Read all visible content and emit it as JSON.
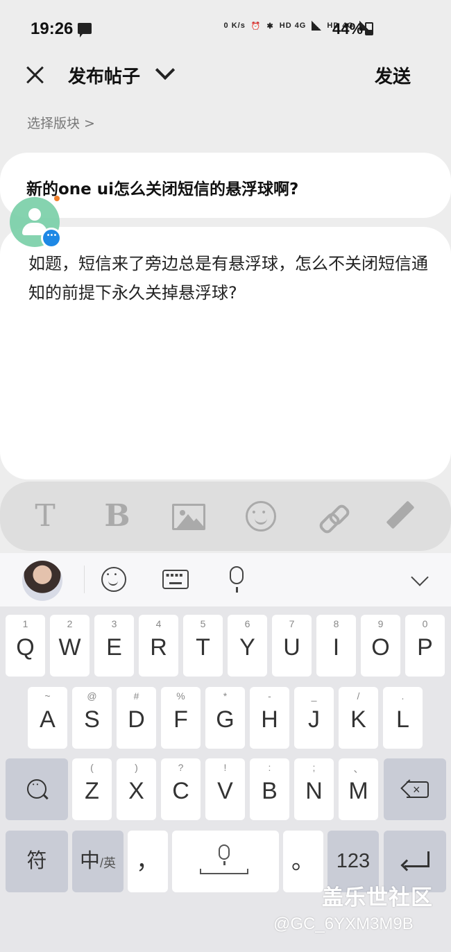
{
  "status_bar": {
    "time": "19:26",
    "net_speed": "0 K/s",
    "network_1": "HD 4G",
    "network_2": "HD 4G",
    "battery": "44%"
  },
  "header": {
    "title": "发布帖子",
    "send_label": "发送"
  },
  "board_selector": "选择版块 >",
  "post": {
    "title": "新的one ui怎么关闭短信的悬浮球啊?",
    "body": "如题，短信来了旁边总是有悬浮球，怎么不关闭短信通知的前提下永久关掉悬浮球?"
  },
  "format_toolbar": {
    "text_label": "T",
    "bold_label": "B"
  },
  "keyboard": {
    "row1": [
      {
        "hint": "1",
        "key": "Q"
      },
      {
        "hint": "2",
        "key": "W"
      },
      {
        "hint": "3",
        "key": "E"
      },
      {
        "hint": "4",
        "key": "R"
      },
      {
        "hint": "5",
        "key": "T"
      },
      {
        "hint": "6",
        "key": "Y"
      },
      {
        "hint": "7",
        "key": "U"
      },
      {
        "hint": "8",
        "key": "I"
      },
      {
        "hint": "9",
        "key": "O"
      },
      {
        "hint": "0",
        "key": "P"
      }
    ],
    "row2": [
      {
        "hint": "~",
        "key": "A"
      },
      {
        "hint": "@",
        "key": "S"
      },
      {
        "hint": "#",
        "key": "D"
      },
      {
        "hint": "%",
        "key": "F"
      },
      {
        "hint": "*",
        "key": "G"
      },
      {
        "hint": "-",
        "key": "H"
      },
      {
        "hint": "_",
        "key": "J"
      },
      {
        "hint": "/",
        "key": "K"
      },
      {
        "hint": ".",
        "key": "L"
      }
    ],
    "row3": [
      {
        "hint": "(",
        "key": "Z"
      },
      {
        "hint": ")",
        "key": "X"
      },
      {
        "hint": "?",
        "key": "C"
      },
      {
        "hint": "!",
        "key": "V"
      },
      {
        "hint": ":",
        "key": "B"
      },
      {
        "hint": ";",
        "key": "N"
      },
      {
        "hint": "、",
        "key": "M"
      }
    ],
    "bottom": {
      "symbols": "符",
      "lang_main": "中",
      "lang_sub": "/英",
      "comma": "，",
      "period": "。",
      "numbers": "123"
    }
  },
  "watermark": {
    "site": "盖乐世社区",
    "user": "@GC_6YXM3M9B"
  }
}
